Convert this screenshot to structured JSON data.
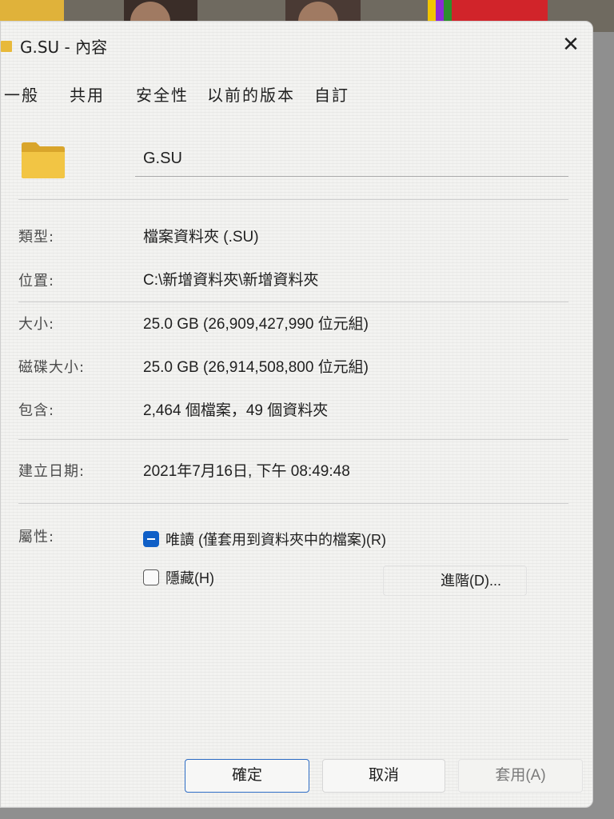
{
  "window": {
    "title": "G.SU - 內容",
    "close_icon": "close-icon"
  },
  "tabs": [
    {
      "label": "一般",
      "selected": true
    },
    {
      "label": "共用",
      "selected": false
    },
    {
      "label": "安全性",
      "selected": false
    },
    {
      "label": "以前的版本",
      "selected": false
    },
    {
      "label": "自訂",
      "selected": false
    }
  ],
  "general": {
    "folder_icon": "folder-icon",
    "name": "G.SU",
    "rows": [
      {
        "label": "類型:",
        "value": "檔案資料夾 (.SU)"
      },
      {
        "label": "位置:",
        "value": "C:\\新增資料夾\\新增資料夾"
      },
      {
        "label": "大小:",
        "value": "25.0 GB (26,909,427,990 位元組)"
      },
      {
        "label": "磁碟大小:",
        "value": "25.0 GB (26,914,508,800 位元組)"
      },
      {
        "label": "包含:",
        "value": "2,464 個檔案，49 個資料夾"
      },
      {
        "label": "建立日期:",
        "value": "2021年7月16日, 下午 08:49:48"
      }
    ],
    "attributes": {
      "label": "屬性:",
      "readonly_label": "唯讀 (僅套用到資料夾中的檔案)(R)",
      "readonly_state": "indeterminate",
      "hidden_label": "隱藏(H)",
      "hidden_state": "unchecked",
      "advanced_label": "進階(D)..."
    }
  },
  "footer": {
    "ok_label": "確定",
    "cancel_label": "取消",
    "apply_label": "套用(A)"
  },
  "colors": {
    "dialog_bg": "#f3f3f1",
    "accent": "#0f5fc7",
    "folder": "#e8b93a"
  }
}
